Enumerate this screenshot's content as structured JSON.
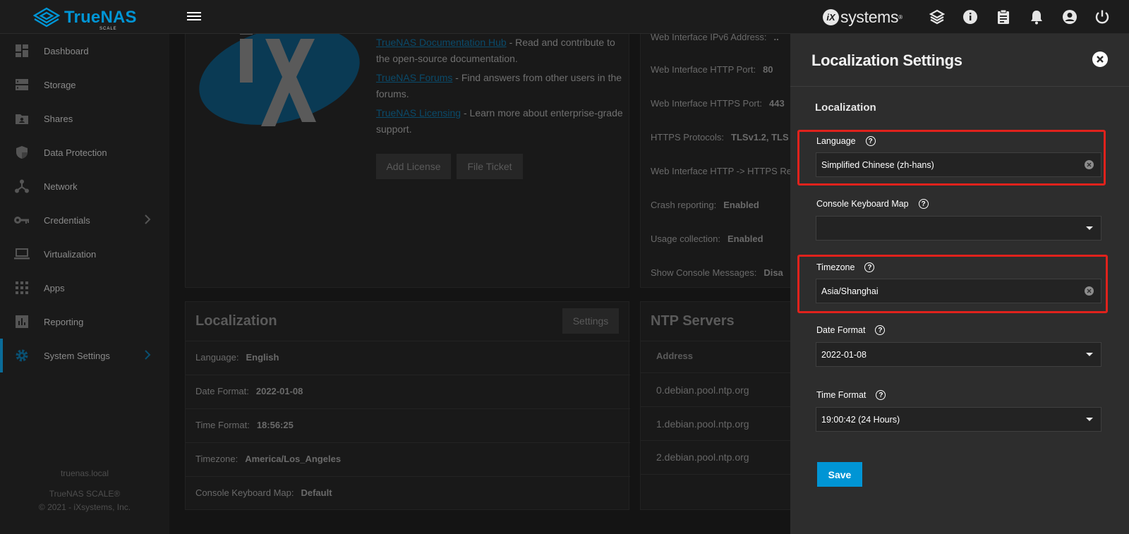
{
  "brand": {
    "logo_text": "TrueNAS",
    "logo_sub": "SCALE",
    "vendor_i": "iX",
    "vendor_word": "systems"
  },
  "topbar": {
    "icons": [
      "menu-icon",
      "truecommand-icon",
      "info-icon",
      "clipboard-icon",
      "bell-icon",
      "account-icon",
      "power-icon"
    ]
  },
  "sidebar": {
    "items": [
      {
        "label": "Dashboard",
        "icon": "dashboard-icon"
      },
      {
        "label": "Storage",
        "icon": "storage-icon"
      },
      {
        "label": "Shares",
        "icon": "shares-icon"
      },
      {
        "label": "Data Protection",
        "icon": "shield-icon"
      },
      {
        "label": "Network",
        "icon": "network-icon"
      },
      {
        "label": "Credentials",
        "icon": "key-icon"
      },
      {
        "label": "Virtualization",
        "icon": "monitor-icon"
      },
      {
        "label": "Apps",
        "icon": "apps-grid-icon"
      },
      {
        "label": "Reporting",
        "icon": "chart-icon"
      },
      {
        "label": "System Settings",
        "icon": "gear-icon"
      }
    ],
    "hostname": "truenas.local",
    "product": "TrueNAS SCALE®",
    "copyright": "© 2021 - iXsystems, Inc."
  },
  "support_card": {
    "doc_link": "TrueNAS Documentation Hub",
    "doc_text": " - Read and contribute to the open-source documentation.",
    "forum_link": "TrueNAS Forums",
    "forum_text": " - Find answers from other users in the forums.",
    "licensing_link": "TrueNAS Licensing",
    "licensing_text": " - Learn more about enterprise-grade support.",
    "add_license": "Add License",
    "file_ticket": "File Ticket"
  },
  "gui_card": {
    "rows": [
      {
        "label": "Web Interface IPv6 Address:",
        "value": ".."
      },
      {
        "label": "Web Interface HTTP Port:",
        "value": "80"
      },
      {
        "label": "Web Interface HTTPS Port:",
        "value": "443"
      },
      {
        "label": "HTTPS Protocols:",
        "value": "TLSv1.2, TLS"
      },
      {
        "label": "Web Interface HTTP -> HTTPS Re",
        "value": ""
      },
      {
        "label": "Crash reporting:",
        "value": "Enabled"
      },
      {
        "label": "Usage collection:",
        "value": "Enabled"
      },
      {
        "label": "Show Console Messages:",
        "value": "Disa"
      }
    ]
  },
  "localization_card": {
    "title": "Localization",
    "settings_button": "Settings",
    "rows": [
      {
        "label": "Language:",
        "value": "English"
      },
      {
        "label": "Date Format:",
        "value": "2022-01-08"
      },
      {
        "label": "Time Format:",
        "value": "18:56:25"
      },
      {
        "label": "Timezone:",
        "value": "America/Los_Angeles"
      },
      {
        "label": "Console Keyboard Map:",
        "value": "Default"
      }
    ]
  },
  "ntp_card": {
    "title": "NTP Servers",
    "column": "Address",
    "rows": [
      "0.debian.pool.ntp.org",
      "1.debian.pool.ntp.org",
      "2.debian.pool.ntp.org"
    ]
  },
  "panel": {
    "title": "Localization Settings",
    "section": "Localization",
    "language_label": "Language",
    "language_value": "Simplified Chinese (zh-hans)",
    "keymap_label": "Console Keyboard Map",
    "keymap_value": "",
    "timezone_label": "Timezone",
    "timezone_value": "Asia/Shanghai",
    "date_format_label": "Date Format",
    "date_format_value": "2022-01-08",
    "time_format_label": "Time Format",
    "time_format_value": "19:00:42 (24 Hours)",
    "save_label": "Save",
    "help_glyph": "?"
  },
  "colors": {
    "accent": "#0095d5",
    "highlight": "#e0221c",
    "panel_bg": "#2d2d2d"
  }
}
